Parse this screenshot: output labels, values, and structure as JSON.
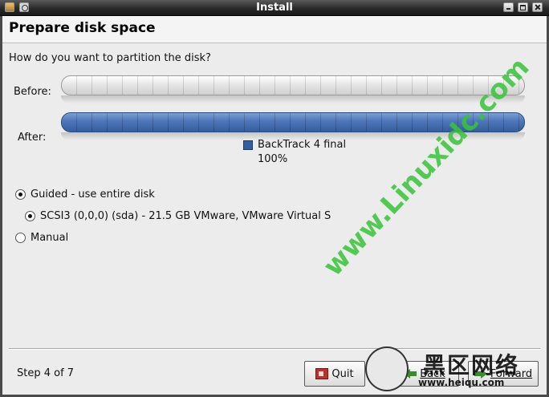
{
  "window": {
    "title": "Install"
  },
  "header": {
    "title": "Prepare disk space"
  },
  "main": {
    "question": "How do you want to partition the disk?",
    "before_label": "Before:",
    "after_label": "After:",
    "partition_legend": {
      "name": "BackTrack 4 final",
      "percent": "100%",
      "fraction": 1.0,
      "color": "#355e9e"
    },
    "options": {
      "guided": "Guided - use entire disk",
      "disk": "SCSI3 (0,0,0) (sda) - 21.5 GB VMware, VMware Virtual S",
      "manual": "Manual"
    },
    "selected_option": "guided"
  },
  "footer": {
    "step": "Step 4 of 7",
    "quit_label": "Quit",
    "back_label": "Back",
    "forward_label": "Forward"
  },
  "watermark": {
    "text": "www.Linuxidc.com",
    "brand_cn": "黑区网络",
    "url": "www.heiqu.com",
    "color": "#39c43a"
  }
}
